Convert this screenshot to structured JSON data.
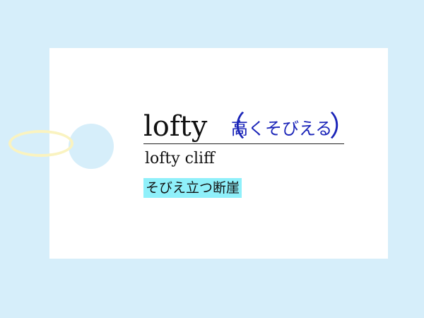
{
  "card": {
    "headword": "lofty",
    "paren_open": "（",
    "reading": "高くそびえる",
    "paren_close": "）",
    "example_en": "lofty cliff",
    "example_ja": "そびえ立つ断崖"
  },
  "colors": {
    "background": "#d6eefa",
    "card": "#ffffff",
    "reading_text": "#1a24b8",
    "highlight": "#8ff0fa",
    "string": "#faf3c0"
  }
}
